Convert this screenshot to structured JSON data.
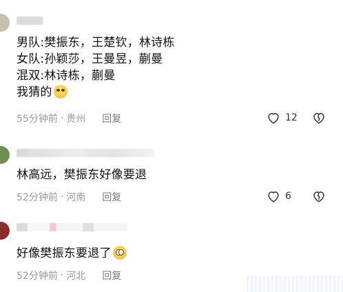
{
  "comments": [
    {
      "lines": [
        "男队:樊振东，王楚钦，林诗栋",
        "女队:孙颖莎，王曼昱，蒯曼",
        "混双:林诗栋，蒯曼",
        "我猜的"
      ],
      "emoji": "grin-emoji",
      "time": "55分钟前",
      "location": "贵州",
      "reply": "回复",
      "likes": "12"
    },
    {
      "lines": [
        "林高远，樊振东好像要退"
      ],
      "time": "52分钟前",
      "location": "河南",
      "reply": "回复",
      "likes": "6"
    },
    {
      "lines": [
        "好像樊振东要退了"
      ],
      "emoji": "pleading-emoji",
      "time": "52分钟前",
      "location": "河北",
      "reply": "回复"
    }
  ],
  "separator": "·",
  "colors": {
    "text": "#111111",
    "meta": "#9a9a9a",
    "icon": "#333333"
  }
}
